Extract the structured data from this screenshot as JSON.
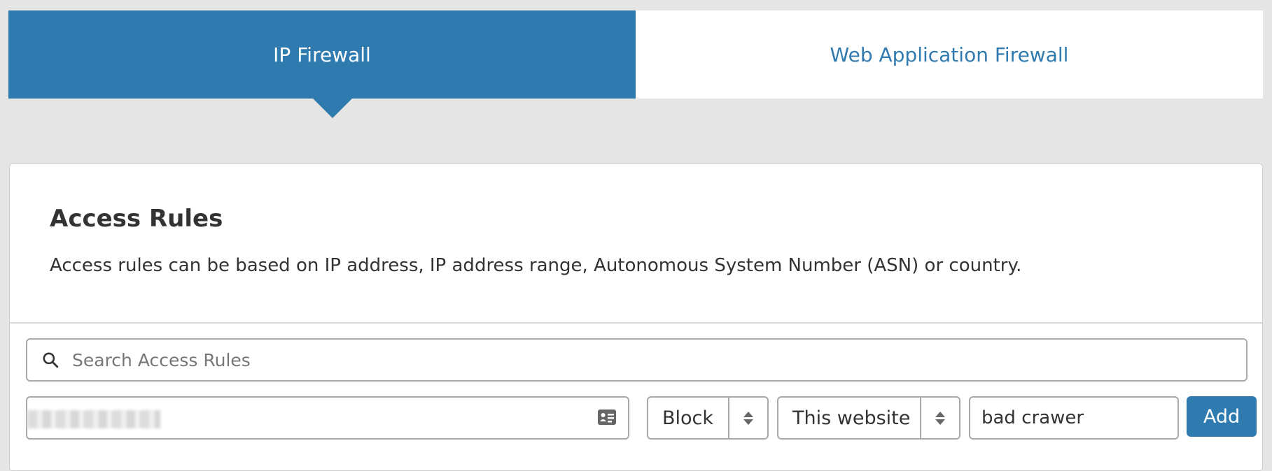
{
  "tabs": [
    {
      "label": "IP Firewall",
      "active": true
    },
    {
      "label": "Web Application Firewall",
      "active": false
    }
  ],
  "card": {
    "title": "Access Rules",
    "description": "Access rules can be based on IP address, IP address range, Autonomous System Number (ASN) or country."
  },
  "search": {
    "placeholder": "Search Access Rules",
    "icon": "search-icon"
  },
  "form": {
    "value_icon": "id-card-icon",
    "action": "Block",
    "scope": "This website",
    "note": "bad crawer",
    "add_label": "Add"
  },
  "colors": {
    "accent": "#2f7bb0",
    "background": "#e5e5e5"
  }
}
